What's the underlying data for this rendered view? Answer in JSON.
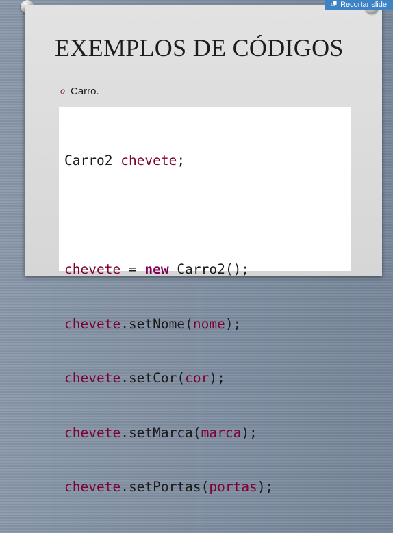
{
  "colors": {
    "keyword": "#7f0055",
    "identifier": "#7f0033",
    "plain": "#1a1a1a",
    "button": "#3d83c5"
  },
  "toolbar": {
    "clip_icon": "crop-icon",
    "clip_label": "Recortar slide"
  },
  "slide": {
    "title": "EXEMPLOS DE CÓDIGOS",
    "bullet_marker": "o",
    "bullet_text": "Carro.",
    "code": {
      "line1": {
        "type": "Carro2",
        "space": " ",
        "var": "chevete",
        "semi": ";"
      },
      "line3": {
        "var": "chevete",
        "eq": " = ",
        "kw": "new",
        "space": " ",
        "cls": "Carro2",
        "call": "();"
      },
      "line4": {
        "obj": "chevete",
        "dot": ".",
        "method": "setNome",
        "open": "(",
        "arg": "nome",
        "close": ");"
      },
      "line5": {
        "obj": "chevete",
        "dot": ".",
        "method": "setCor",
        "open": "(",
        "arg": "cor",
        "close": ");"
      },
      "line6": {
        "obj": "chevete",
        "dot": ".",
        "method": "setMarca",
        "open": "(",
        "arg": "marca",
        "close": ");"
      },
      "line7": {
        "obj": "chevete",
        "dot": ".",
        "method": "setPortas",
        "open": "(",
        "arg": "portas",
        "close": ");"
      }
    }
  }
}
